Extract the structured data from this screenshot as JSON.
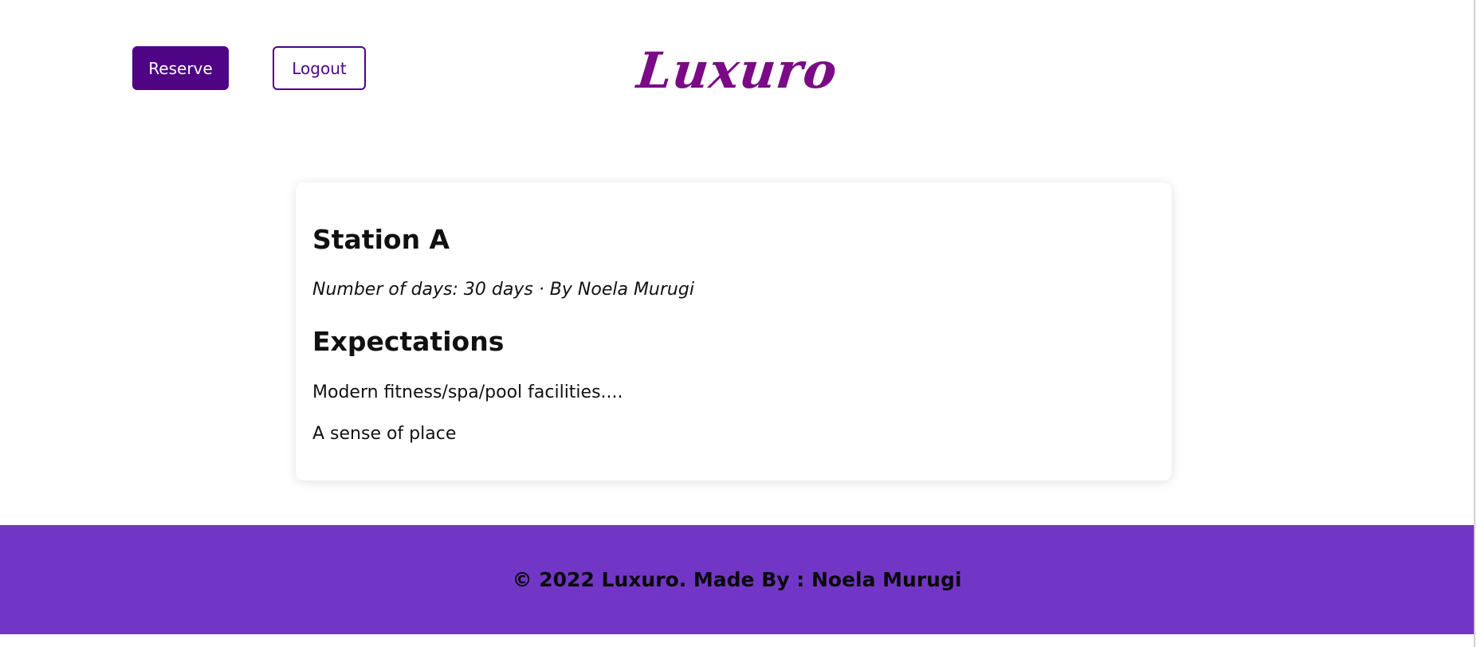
{
  "header": {
    "reserve_label": "Reserve",
    "logout_label": "Logout",
    "logo_text": "Luxuro"
  },
  "card": {
    "title": "Station A",
    "meta": "Number of days: 30 days · By Noela Murugi",
    "subtitle": "Expectations",
    "lines": [
      "Modern fitness/spa/pool facilities....",
      "A sense of place"
    ]
  },
  "footer": {
    "text": "© 2022 Luxuro. Made By : Noela Murugi"
  },
  "colors": {
    "primary": "#4e0485",
    "logo": "#7a0a86",
    "footer_bg": "#7236c6"
  }
}
